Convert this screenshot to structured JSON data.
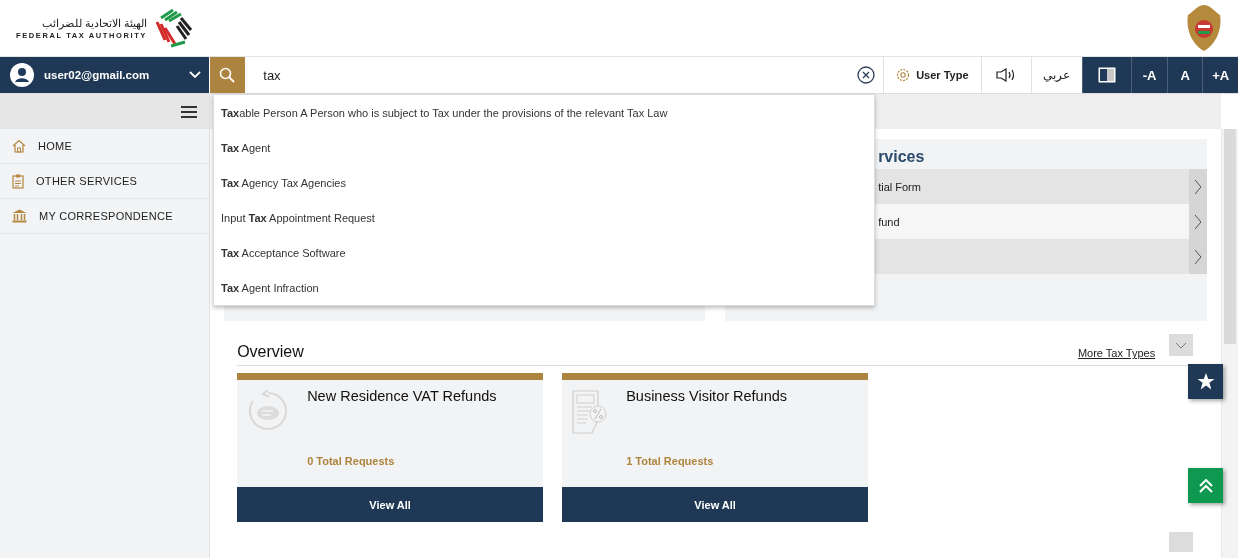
{
  "header": {
    "logo_arabic": "الهيئة الاتحادية للضرائب",
    "logo_english": "FEDERAL TAX AUTHORITY"
  },
  "user_menu": {
    "email": "user02@gmail.com"
  },
  "search": {
    "value": "tax",
    "suggestions": [
      {
        "text": "**Tax**able Person A Person who is subject to Tax under the provisions of the relevant Tax Law"
      },
      {
        "text": "**Tax** Agent"
      },
      {
        "text": "**Tax** Agency Tax Agencies"
      },
      {
        "text": "Input **Tax** Appointment Request"
      },
      {
        "text": "**Tax** Acceptance Software"
      },
      {
        "text": "**Tax** Agent Infraction"
      }
    ]
  },
  "toolbar": {
    "user_type": "User Type",
    "language": "عربي",
    "font_buttons": [
      "-A",
      "A",
      "+A"
    ]
  },
  "sidebar": {
    "items": [
      {
        "label": "HOME",
        "kind": "home"
      },
      {
        "label": "OTHER SERVICES",
        "kind": "clipboard"
      },
      {
        "label": "MY CORRESPONDENCE",
        "kind": "bank"
      }
    ]
  },
  "services_card": {
    "title": "rvices",
    "rows": [
      {
        "text": "tial Form",
        "shaded": true
      },
      {
        "text": "fund",
        "shaded": false
      },
      {
        "shaded": true
      }
    ]
  },
  "overview": {
    "title": "Overview",
    "more_link": "More Tax Types",
    "cards": [
      {
        "title": "New Residence VAT Refunds",
        "count": "0 Total Requests",
        "button": "View All",
        "kind": "refund"
      },
      {
        "title": "Business Visitor Refunds",
        "count": "1 Total Requests",
        "button": "View All",
        "kind": "document"
      }
    ]
  }
}
